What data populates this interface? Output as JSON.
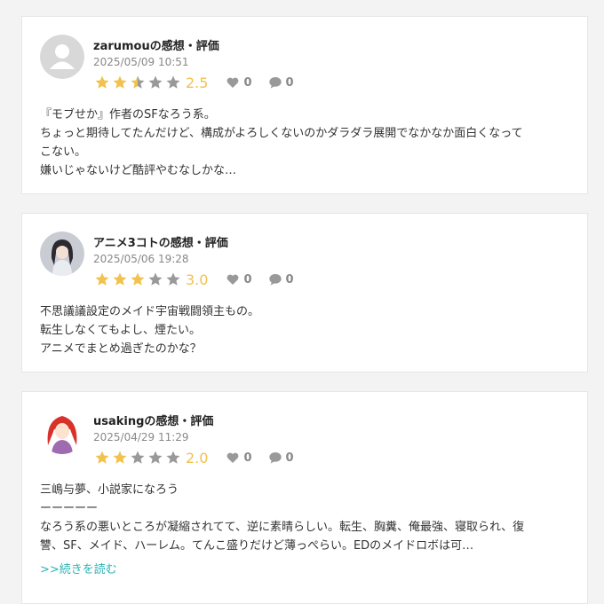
{
  "colors": {
    "star_filled": "#f2c14e",
    "star_empty": "#999999",
    "link": "#2db3b3",
    "count": "#888888"
  },
  "reviews": [
    {
      "title": "zarumouの感想・評価",
      "date": "2025/05/09 10:51",
      "rating": 2.5,
      "rating_text": "2.5",
      "likes": "0",
      "comments": "0",
      "avatar": "default-user-icon",
      "lines": [
        "『モブせか』作者のSFなろう系。",
        "ちょっと期待してたんだけど、構成がよろしくないのかダラダラ展開でなかなか面白くなって",
        "こない。",
        "嫌いじゃないけど酷評やむなしかな…"
      ]
    },
    {
      "title": "アニメ3コトの感想・評価",
      "date": "2025/05/06 19:28",
      "rating": 3.0,
      "rating_text": "3.0",
      "likes": "0",
      "comments": "0",
      "avatar": "anime-girl-avatar",
      "lines": [
        "不思議議設定のメイド宇宙戦闘領主もの。",
        "転生しなくてもよし、煙たい。",
        "アニメでまとめ過ぎたのかな？"
      ]
    },
    {
      "title": "usakingの感想・評価",
      "date": "2025/04/29 11:29",
      "rating": 2.0,
      "rating_text": "2.0",
      "likes": "0",
      "comments": "0",
      "avatar": "red-hair-girl-avatar",
      "lines": [
        "三嶋与夢、小説家になろう",
        "ーーーーー",
        "なろう系の悪いところが凝縮されてて、逆に素晴らしい。転生、胸糞、俺最強、寝取られ、復",
        "讐、SF、メイド、ハーレム。てんこ盛りだけど薄っぺらい。EDのメイドロボは可…"
      ],
      "more_label": ">>続きを読む"
    }
  ]
}
